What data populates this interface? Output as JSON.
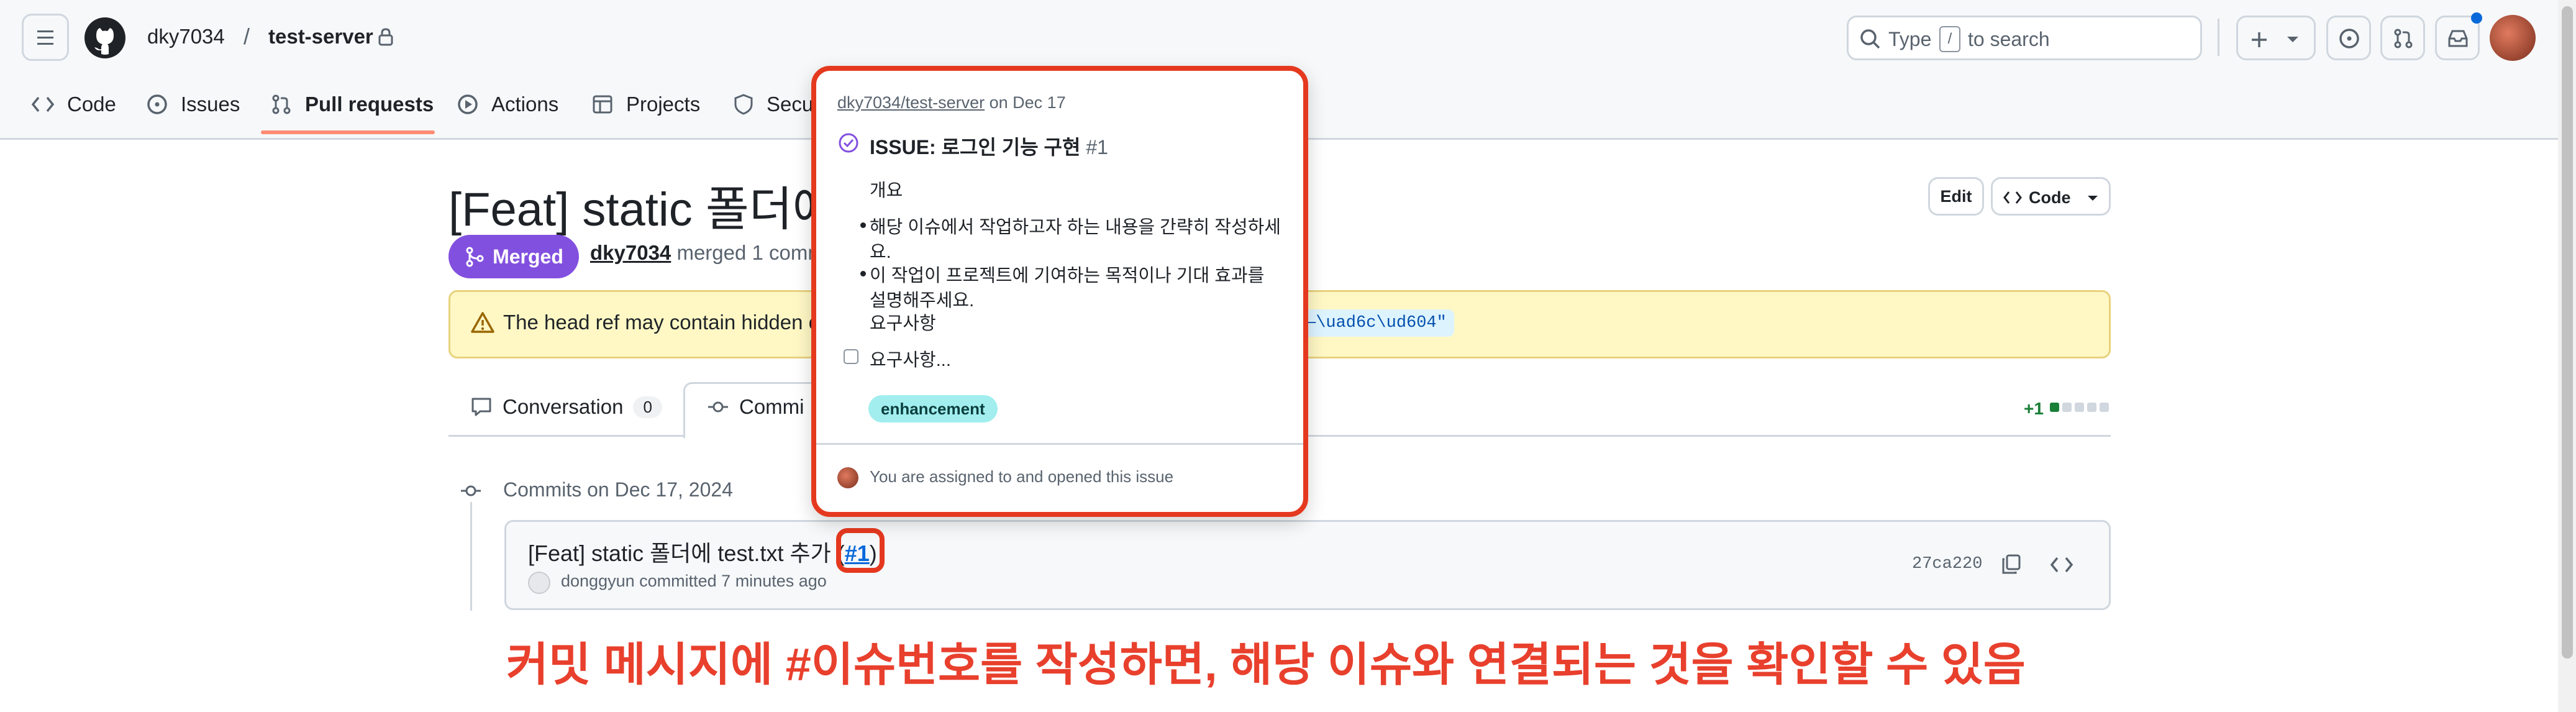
{
  "header": {
    "owner": "dky7034",
    "separator": "/",
    "repo": "test-server",
    "search_type": "Type",
    "search_key": "/",
    "search_rest": "to search"
  },
  "nav": {
    "code": "Code",
    "issues": "Issues",
    "pull_requests": "Pull requests",
    "actions": "Actions",
    "projects": "Projects",
    "security": "Secu"
  },
  "pr": {
    "title": "[Feat] static 폴더에 t",
    "status": "Merged",
    "author": "dky7034",
    "merged_text": "merged 1 comm",
    "edit_label": "Edit",
    "code_label": "Code"
  },
  "warning": {
    "text": "The head ref may contain hidden c",
    "code": "—\\uad6c\\ud604\""
  },
  "tabs": {
    "conversation": "Conversation",
    "conversation_count": "0",
    "commits": "Commi",
    "diffstat": "+1"
  },
  "commits": {
    "heading": "Commits on Dec 17, 2024",
    "message": "[Feat] static 폴더에 test.txt 추가 (",
    "link": "#1",
    "close_paren": ")",
    "author": "donggyun",
    "committed": "committed 7 minutes ago",
    "sha": "27ca220"
  },
  "hovercard": {
    "repo": "dky7034/test-server",
    "date": "on Dec 17",
    "title": "ISSUE: 로그인 기능 구현",
    "number": "#1",
    "overview": "개요",
    "bullet1_a": "해당 이슈에서 작업하고자 하는 내용을 간략히 작성하세",
    "bullet1_b": "요.",
    "bullet2_a": "이 작업이 프로젝트에 기여하는 목적이나 기대 효과를",
    "bullet2_b": "설명해주세요.",
    "requirements": "요구사항",
    "checkbox_text": "요구사항...",
    "label": "enhancement",
    "footer": "You are assigned to and opened this issue"
  },
  "annotation": "커밋 메시지에 #이슈번호를 작성하면, 해당 이슈와 연결되는 것을 확인할 수 있음",
  "colors": {
    "merged": "#8250df",
    "annotation": "#e8402d",
    "link": "#0969da",
    "label_bg": "#a2eeef"
  }
}
